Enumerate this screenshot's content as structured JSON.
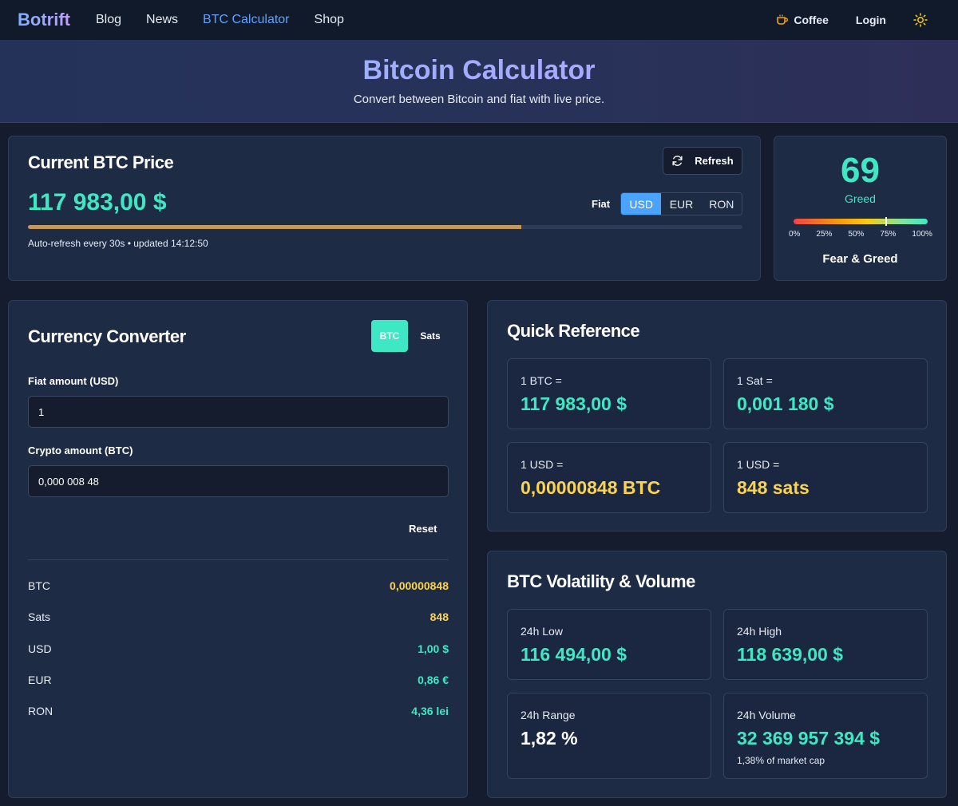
{
  "nav": {
    "brand": "Botrift",
    "links": [
      "Blog",
      "News",
      "BTC Calculator",
      "Shop"
    ],
    "coffee": "Coffee",
    "login": "Login"
  },
  "hero": {
    "title": "Bitcoin Calculator",
    "subtitle": "Convert between Bitcoin and fiat with live price."
  },
  "price": {
    "title": "Current BTC Price",
    "value": "117 983,00 $",
    "refresh_label": "Refresh",
    "fiat_label": "Fiat",
    "fiat_options": [
      "USD",
      "EUR",
      "RON"
    ],
    "fiat_selected": "USD",
    "refresh_progress": 0.69,
    "status": "Auto-refresh every 30s • updated 14:12:50"
  },
  "fear_greed": {
    "value": "69",
    "label": "Greed",
    "ticks": [
      "0%",
      "25%",
      "50%",
      "75%",
      "100%"
    ],
    "title": "Fear & Greed",
    "level": 0.69
  },
  "converter": {
    "title": "Currency Converter",
    "unit_btc": "BTC",
    "unit_sats": "Sats",
    "fiat_label": "Fiat amount (USD)",
    "fiat_value": "1",
    "crypto_label": "Crypto amount (BTC)",
    "crypto_value": "0,000 008 48",
    "reset_label": "Reset",
    "results": [
      {
        "key": "BTC",
        "value": "0,00000848"
      },
      {
        "key": "Sats",
        "value": "848"
      },
      {
        "key": "USD",
        "value": "1,00 $"
      },
      {
        "key": "EUR",
        "value": "0,86 €"
      },
      {
        "key": "RON",
        "value": "4,36 lei"
      }
    ]
  },
  "quick_reference": {
    "title": "Quick Reference",
    "tiles": [
      {
        "label": "1 BTC =",
        "value": "117 983,00 $"
      },
      {
        "label": "1 Sat =",
        "value": "0,001 180 $"
      },
      {
        "label": "1 USD =",
        "value": "0,00000848 BTC"
      },
      {
        "label": "1 USD =",
        "value": "848 sats"
      }
    ]
  },
  "volatility": {
    "title": "BTC Volatility & Volume",
    "tiles": [
      {
        "label": "24h Low",
        "value": "116 494,00 $"
      },
      {
        "label": "24h High",
        "value": "118 639,00 $"
      },
      {
        "label": "24h Range",
        "value": "1,82 %"
      },
      {
        "label": "24h Volume",
        "value": "32 369 957 394 $",
        "sub": "1,38% of market cap"
      }
    ]
  },
  "colors": {
    "accent_teal": "#3ee8c4",
    "accent_yellow": "#fcd34d",
    "accent_blue": "#4aa3ff",
    "background": "#141c2e",
    "card": "#1e2b45"
  }
}
